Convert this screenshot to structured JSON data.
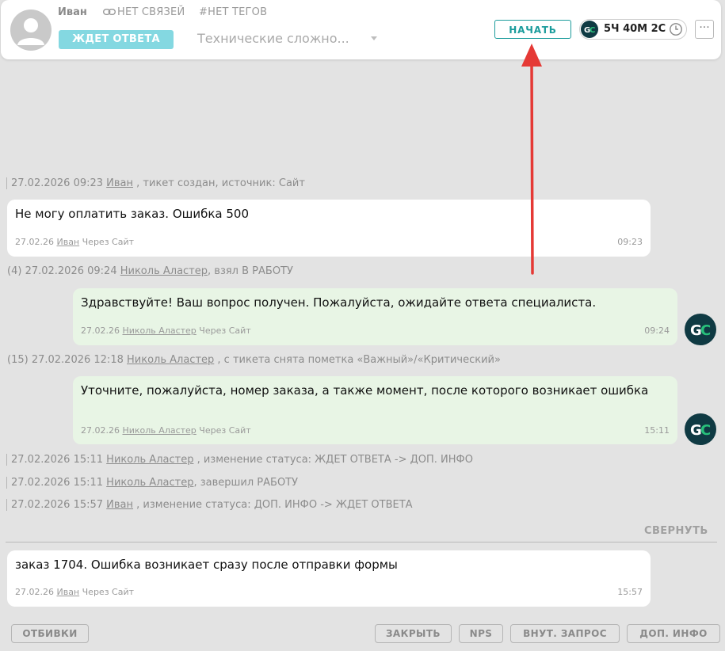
{
  "header": {
    "name": "Иван",
    "links": "НЕТ СВЯЗЕЙ",
    "tags": "#НЕТ ТЕГОВ",
    "status": "ЖДЕТ ОТВЕТА",
    "topic": "Технические сложно...",
    "start_label": "НАЧАТЬ",
    "timer": "5Ч 40М 2С",
    "more_label": "···"
  },
  "colors": {
    "status_badge": "#84d8e1",
    "accent_teal": "#1b9c9c",
    "agent_bubble": "#e8f5e5",
    "gc_dark": "#0f3a43",
    "gc_green": "#28c07b",
    "arrow": "#e53935"
  },
  "events": [
    {
      "date": "27.02.2026 09:23",
      "user": "Иван",
      "text": ", тикет создан, источник: Сайт"
    },
    {
      "count": "(4)",
      "date": "27.02.2026 09:24",
      "user": "Николь Аластер",
      "text": ", взял В РАБОТУ"
    },
    {
      "count": "(15)",
      "date": "27.02.2026 12:18",
      "user": "Николь Аластер",
      "text": " , с тикета снята пометка «Важный»/«Критический»"
    },
    {
      "date": "27.02.2026 15:11",
      "user": "Николь Аластер",
      "text": " , изменение статуса: ЖДЕТ ОТВЕТА -> ДОП. ИНФО"
    },
    {
      "date": "27.02.2026 15:11",
      "user": "Николь Аластер",
      "text": ", завершил РАБОТУ"
    },
    {
      "date": "27.02.2026 15:57",
      "user": "Иван",
      "text": " , изменение статуса: ДОП. ИНФО -> ЖДЕТ ОТВЕТА"
    }
  ],
  "messages": [
    {
      "text": "Не могу оплатить заказ. Ошибка 500",
      "date": "27.02.26",
      "author": "Иван",
      "via": "Через Сайт",
      "time": "09:23"
    },
    {
      "text": "Здравствуйте! Ваш вопрос получен. Пожалуйста, ожидайте ответа специалиста.",
      "date": "27.02.26",
      "author": "Николь Аластер",
      "via": "Через Сайт",
      "time": "09:24"
    },
    {
      "text": "Уточните, пожалуйста, номер заказа, а также момент, после которого возникает ошибка",
      "date": "27.02.26",
      "author": "Николь Аластер",
      "via": "Через Сайт",
      "time": "15:11"
    },
    {
      "text": "заказ 1704. Ошибка возникает сразу после отправки формы",
      "date": "27.02.26",
      "author": "Иван",
      "via": "Через Сайт",
      "time": "15:57"
    }
  ],
  "collapse_label": "СВЕРНУТЬ",
  "footer": {
    "replies": "ОТБИВКИ",
    "close": "ЗАКРЫТЬ",
    "nps": "NPS",
    "internal": "ВНУТ. ЗАПРОС",
    "extra": "ДОП. ИНФО"
  },
  "agent_logo": "GC"
}
